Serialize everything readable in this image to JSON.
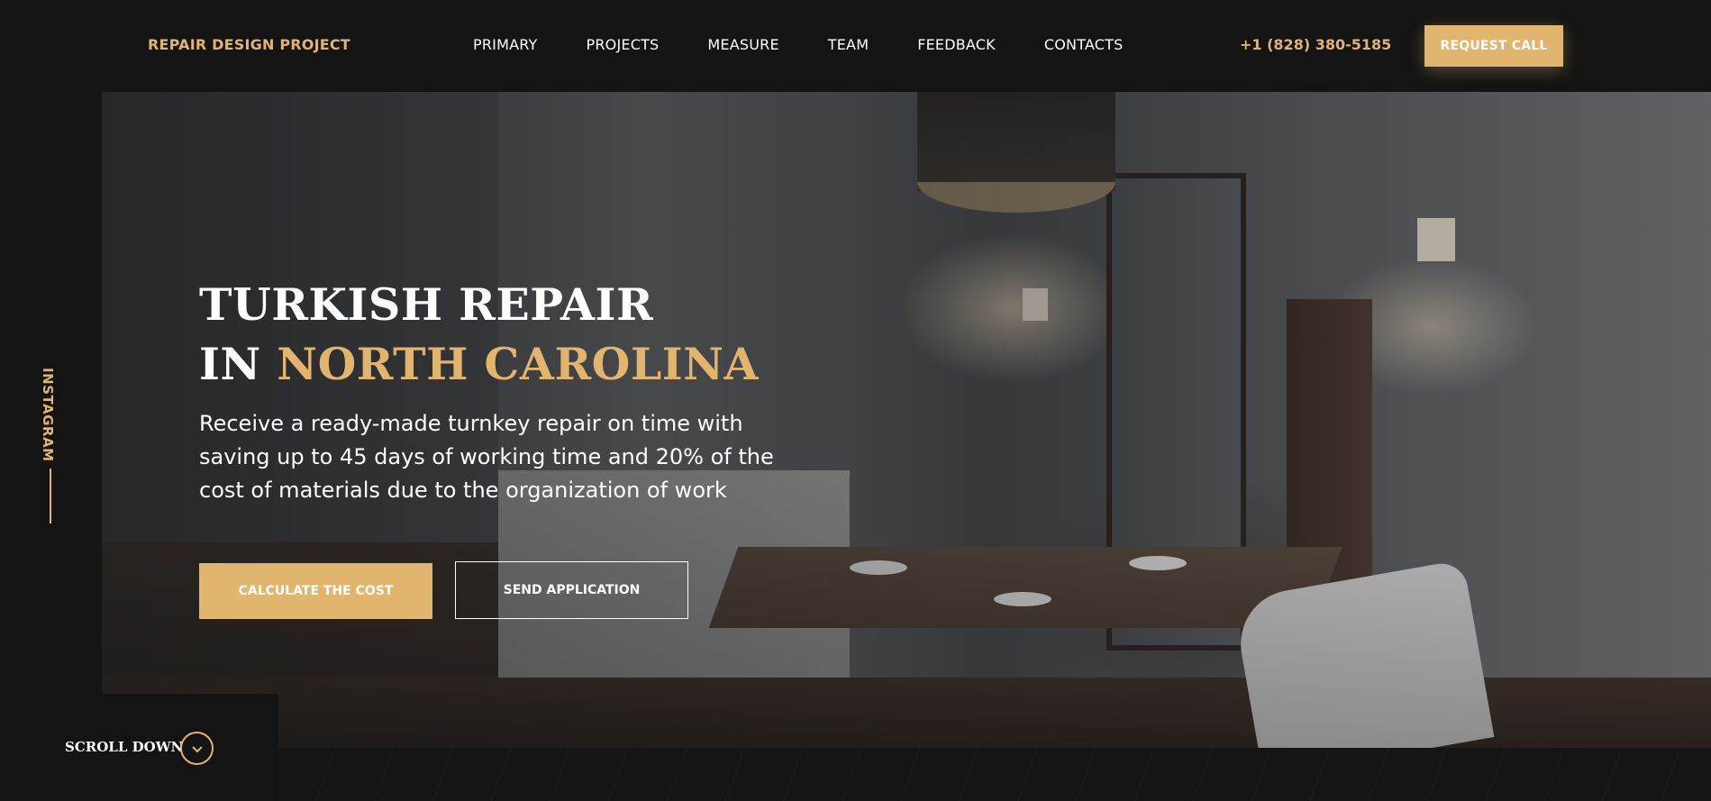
{
  "header": {
    "logo": "REPAIR DESIGN PROJECT",
    "nav": [
      {
        "label": "PRIMARY"
      },
      {
        "label": "PROJECTS"
      },
      {
        "label": "MEASURE"
      },
      {
        "label": "TEAM"
      },
      {
        "label": "FEEDBACK"
      },
      {
        "label": "CONTACTS"
      }
    ],
    "phone": "+1 (828) 380-5185",
    "request_button": "REQUEST CALL"
  },
  "hero": {
    "title_line1": "TURKISH REPAIR",
    "title_line2_prefix": "IN",
    "title_line2_accent": "NORTH CAROLINA",
    "description": "Receive a ready-made turnkey repair on time with saving up to 45 days of working time and 20% of the cost of materials due to the organization of work",
    "calc_button": "CALCULATE THE COST",
    "send_button": "SEND APPLICATION"
  },
  "sidebar": {
    "instagram": "INSTAGRAM"
  },
  "scroll": {
    "label": "SCROLL DOWN",
    "icon": "chevron-down-icon"
  },
  "colors": {
    "accent": "#e2b56f",
    "background": "#141414",
    "text": "#ffffff"
  }
}
